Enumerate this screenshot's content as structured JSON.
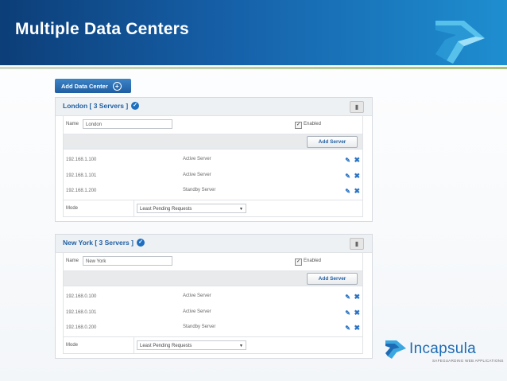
{
  "slide": {
    "title": "Multiple Data Centers"
  },
  "toolbar": {
    "add_dc_label": "Add Data Center",
    "add_dc_icon": "plus-circle-icon"
  },
  "datacenters": [
    {
      "title": "London [ 3 Servers ]",
      "name_label": "Name",
      "name_value": "London",
      "enabled_label": "Enabled",
      "enabled": true,
      "add_server_label": "Add Server",
      "servers": [
        {
          "ip": "192.168.1.100",
          "role": "Active Server"
        },
        {
          "ip": "192.168.1.101",
          "role": "Active Server"
        },
        {
          "ip": "192.168.1.200",
          "role": "Standby Server"
        }
      ],
      "mode_label": "Mode",
      "mode_value": "Least Pending Requests"
    },
    {
      "title": "New York [ 3 Servers ]",
      "name_label": "Name",
      "name_value": "New York",
      "enabled_label": "Enabled",
      "enabled": true,
      "add_server_label": "Add Server",
      "servers": [
        {
          "ip": "192.168.0.100",
          "role": "Active Server"
        },
        {
          "ip": "192.168.0.101",
          "role": "Active Server"
        },
        {
          "ip": "192.168.0.200",
          "role": "Standby Server"
        }
      ],
      "mode_label": "Mode",
      "mode_value": "Least Pending Requests"
    }
  ],
  "brand": {
    "name": "Incapsula",
    "tagline": "SAFEGUARDING WEB APPLICATIONS"
  },
  "colors": {
    "banner": "#1660a8",
    "accent": "#1e5ea2",
    "icon_blue": "#2a73c4"
  }
}
